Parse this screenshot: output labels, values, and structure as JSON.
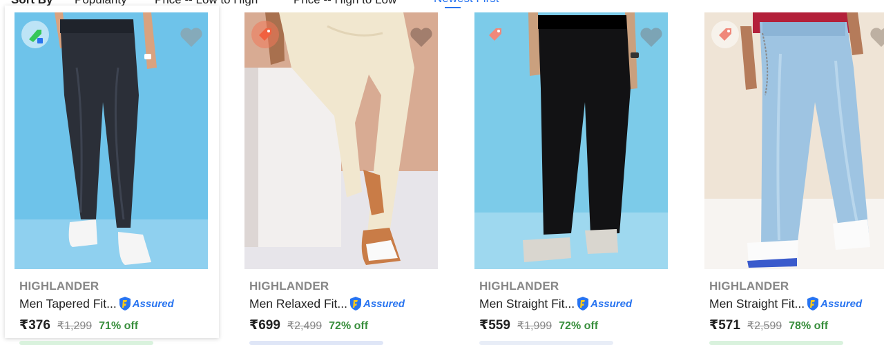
{
  "sort_bar": {
    "title": "Sort By",
    "options": [
      "Popularity",
      "Price -- Low to High",
      "Price -- High to Low",
      "Newest First"
    ],
    "active_option": "Newest First"
  },
  "colors": {
    "accent": "#2874f0",
    "discount": "#388e3c",
    "muted": "#878787"
  },
  "products": [
    {
      "brand": "HIGHLANDER",
      "title": "Men Tapered Fit...",
      "assured_label": "Assured",
      "price": "₹376",
      "mrp": "₹1,299",
      "discount": "71% off",
      "tag_icon": "eco-tag-icon"
    },
    {
      "brand": "HIGHLANDER",
      "title": "Men Relaxed Fit...",
      "assured_label": "Assured",
      "price": "₹699",
      "mrp": "₹2,499",
      "discount": "72% off",
      "tag_icon": "price-tag-icon"
    },
    {
      "brand": "HIGHLANDER",
      "title": "Men Straight Fit...",
      "assured_label": "Assured",
      "price": "₹559",
      "mrp": "₹1,999",
      "discount": "72% off",
      "tag_icon": "price-tag-icon"
    },
    {
      "brand": "HIGHLANDER",
      "title": "Men Straight Fit...",
      "assured_label": "Assured",
      "price": "₹571",
      "mrp": "₹2,599",
      "discount": "78% off",
      "tag_icon": "price-tag-icon"
    }
  ]
}
